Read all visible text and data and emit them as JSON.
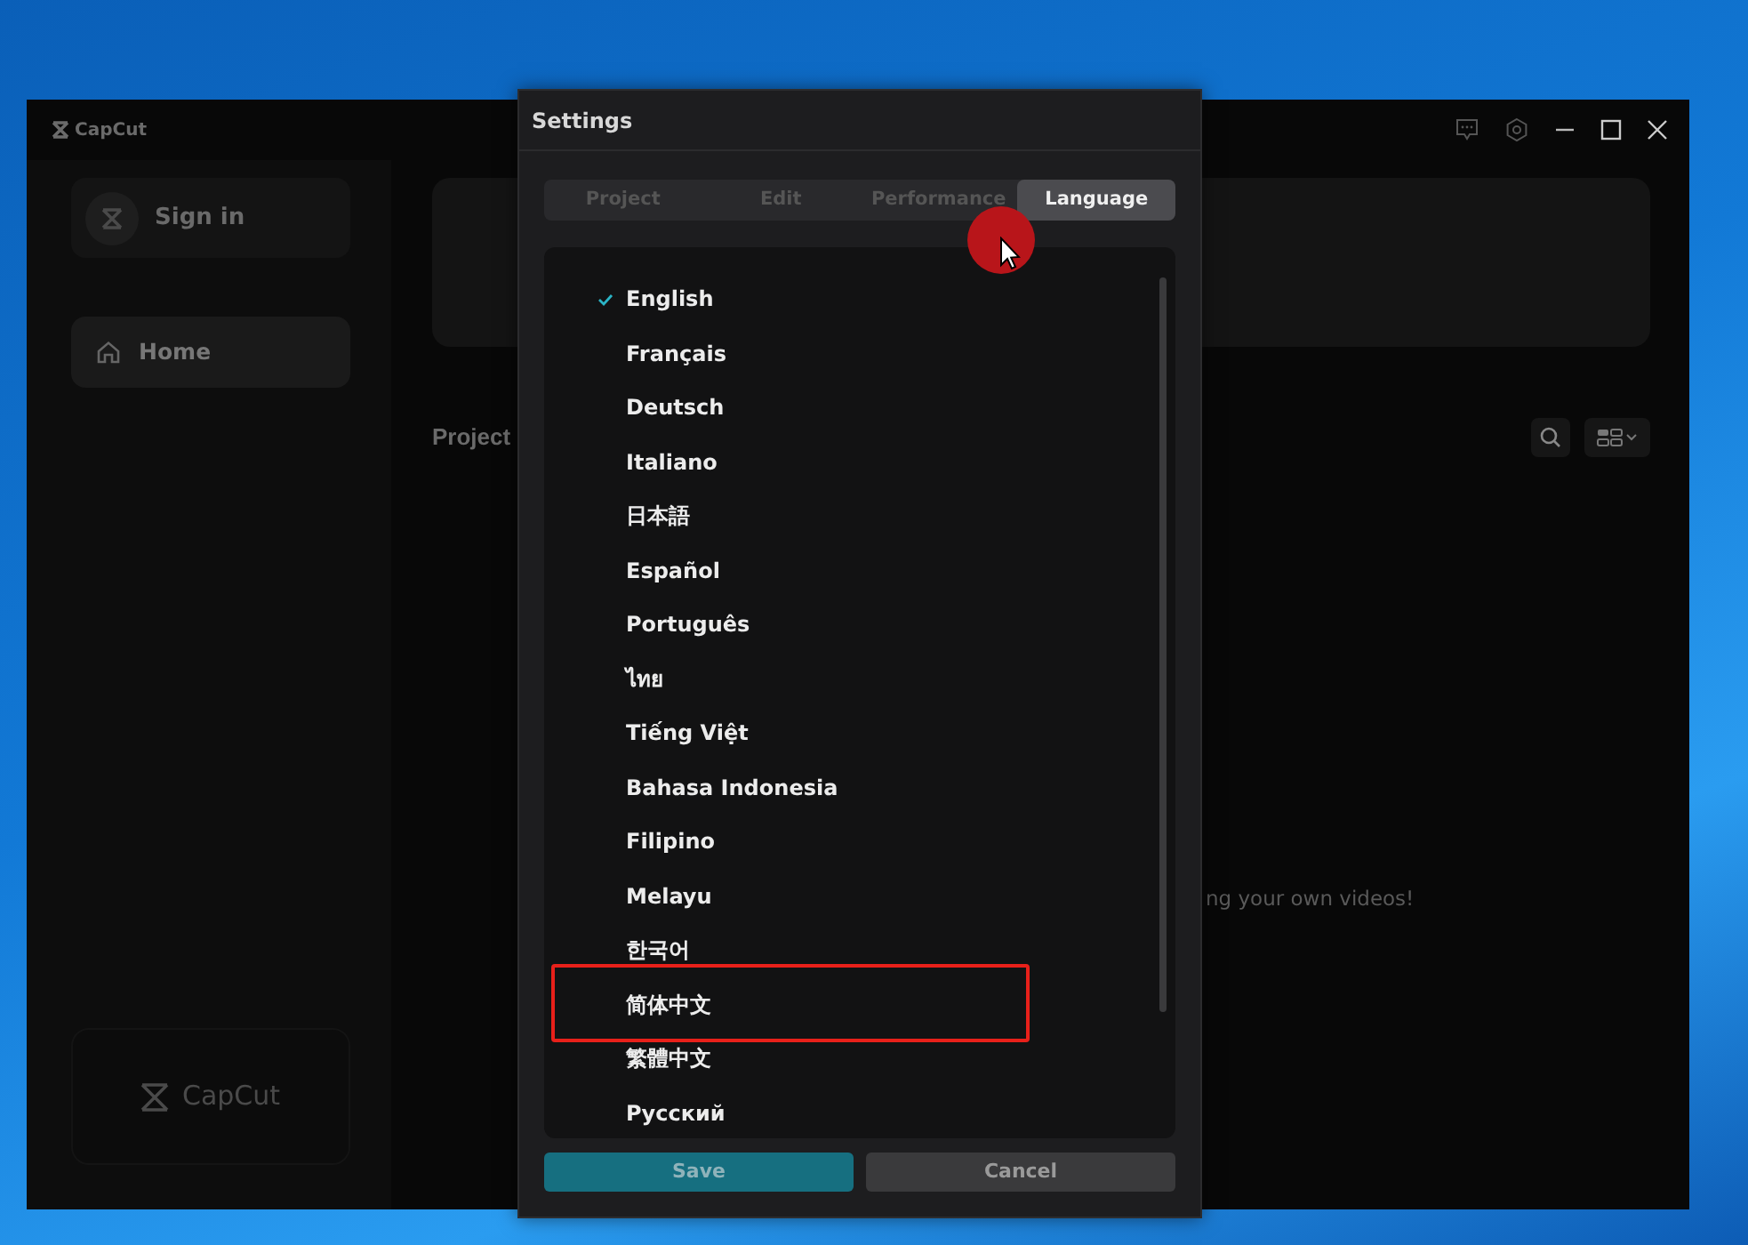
{
  "app": {
    "title": "CapCut",
    "sidebar": {
      "sign_in": "Sign in",
      "nav": [
        {
          "label": "Home",
          "selected": true
        }
      ],
      "promo": "CapCut"
    },
    "main": {
      "section_title": "Project",
      "empty_message": "ng your own videos!"
    }
  },
  "dialog": {
    "title": "Settings",
    "tabs": [
      {
        "label": "Project",
        "selected": false
      },
      {
        "label": "Edit",
        "selected": false
      },
      {
        "label": "Performance",
        "selected": false
      },
      {
        "label": "Language",
        "selected": true
      }
    ],
    "languages": [
      {
        "label": "English",
        "selected": true
      },
      {
        "label": "Français",
        "selected": false
      },
      {
        "label": "Deutsch",
        "selected": false
      },
      {
        "label": "Italiano",
        "selected": false
      },
      {
        "label": "日本語",
        "selected": false
      },
      {
        "label": "Español",
        "selected": false
      },
      {
        "label": "Português",
        "selected": false
      },
      {
        "label": "ไทย",
        "selected": false
      },
      {
        "label": "Tiếng Việt",
        "selected": false
      },
      {
        "label": "Bahasa Indonesia",
        "selected": false
      },
      {
        "label": "Filipino",
        "selected": false
      },
      {
        "label": "Melayu",
        "selected": false
      },
      {
        "label": "한국어",
        "selected": false
      },
      {
        "label": "简体中文",
        "selected": false
      },
      {
        "label": "繁體中文",
        "selected": false
      },
      {
        "label": "Русский",
        "selected": false
      }
    ],
    "buttons": [
      {
        "label": "Save",
        "kind": "primary"
      },
      {
        "label": "Cancel",
        "kind": "secondary"
      }
    ]
  }
}
